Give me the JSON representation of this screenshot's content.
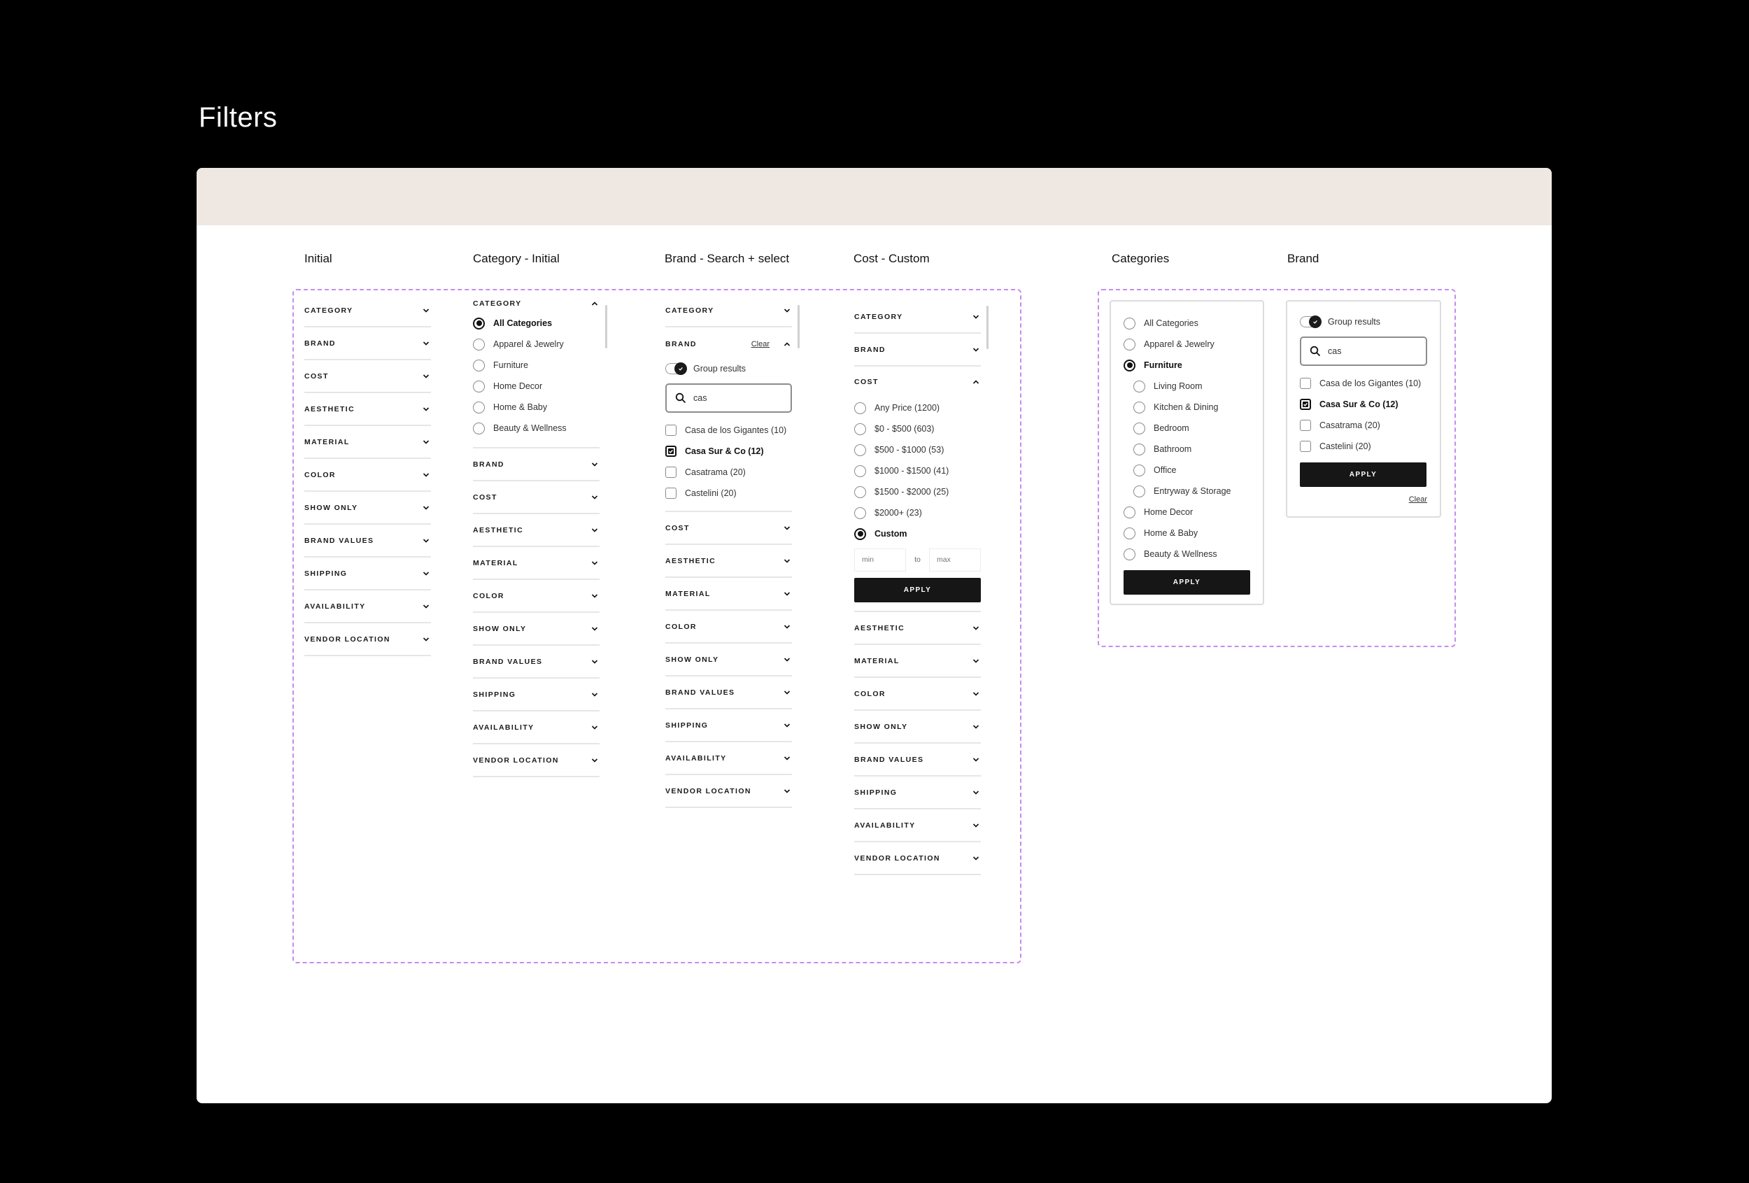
{
  "page": {
    "title": "Filters"
  },
  "colors": {
    "banner": "#efe8e2",
    "dashed_outline": "#c48cf0",
    "button": "#161616"
  },
  "sections": {
    "initial": "Initial",
    "category_initial": "Category - Initial",
    "brand_search": "Brand - Search + select",
    "cost_custom": "Cost - Custom",
    "categories": "Categories",
    "brand": "Brand"
  },
  "filters": [
    "CATEGORY",
    "BRAND",
    "COST",
    "AESTHETIC",
    "MATERIAL",
    "COLOR",
    "SHOW ONLY",
    "BRAND VALUES",
    "SHIPPING",
    "AVAILABILITY",
    "VENDOR LOCATION"
  ],
  "category_options": [
    {
      "label": "All Categories",
      "selected": true
    },
    {
      "label": "Apparel & Jewelry",
      "selected": false
    },
    {
      "label": "Furniture",
      "selected": false
    },
    {
      "label": "Home Decor",
      "selected": false
    },
    {
      "label": "Home & Baby",
      "selected": false
    },
    {
      "label": "Beauty & Wellness",
      "selected": false
    }
  ],
  "brand_panel": {
    "clear_label": "Clear",
    "group_results_label": "Group results",
    "group_results_on": true,
    "search_value": "cas",
    "options": [
      {
        "label": "Casa de los Gigantes (10)",
        "checked": false
      },
      {
        "label": "Casa Sur & Co (12)",
        "checked": true
      },
      {
        "label": "Casatrama (20)",
        "checked": false
      },
      {
        "label": "Castelini (20)",
        "checked": false
      }
    ]
  },
  "cost_panel": {
    "options": [
      {
        "label": "Any Price (1200)",
        "selected": false
      },
      {
        "label": "$0 - $500 (603)",
        "selected": false
      },
      {
        "label": "$500 - $1000 (53)",
        "selected": false
      },
      {
        "label": "$1000 - $1500 (41)",
        "selected": false
      },
      {
        "label": "$1500 - $2000 (25)",
        "selected": false
      },
      {
        "label": "$2000+ (23)",
        "selected": false
      },
      {
        "label": "Custom",
        "selected": true
      }
    ],
    "min_placeholder": "min",
    "to_label": "to",
    "max_placeholder": "max",
    "apply_label": "APPLY"
  },
  "categories_panel": {
    "options": [
      {
        "label": "All Categories",
        "selected": false,
        "sub": false
      },
      {
        "label": "Apparel & Jewelry",
        "selected": false,
        "sub": false
      },
      {
        "label": "Furniture",
        "selected": true,
        "sub": false
      },
      {
        "label": "Living Room",
        "selected": false,
        "sub": true
      },
      {
        "label": "Kitchen & Dining",
        "selected": false,
        "sub": true
      },
      {
        "label": "Bedroom",
        "selected": false,
        "sub": true
      },
      {
        "label": "Bathroom",
        "selected": false,
        "sub": true
      },
      {
        "label": "Office",
        "selected": false,
        "sub": true
      },
      {
        "label": "Entryway & Storage",
        "selected": false,
        "sub": true
      },
      {
        "label": "Home Decor",
        "selected": false,
        "sub": false
      },
      {
        "label": "Home & Baby",
        "selected": false,
        "sub": false
      },
      {
        "label": "Beauty & Wellness",
        "selected": false,
        "sub": false
      }
    ],
    "apply_label": "APPLY"
  },
  "brand_dropdown": {
    "group_results_label": "Group results",
    "search_value": "cas",
    "options": [
      {
        "label": "Casa de los Gigantes (10)",
        "checked": false
      },
      {
        "label": "Casa Sur & Co (12)",
        "checked": true
      },
      {
        "label": "Casatrama (20)",
        "checked": false
      },
      {
        "label": "Castelini (20)",
        "checked": false
      }
    ],
    "apply_label": "APPLY",
    "clear_label": "Clear"
  }
}
